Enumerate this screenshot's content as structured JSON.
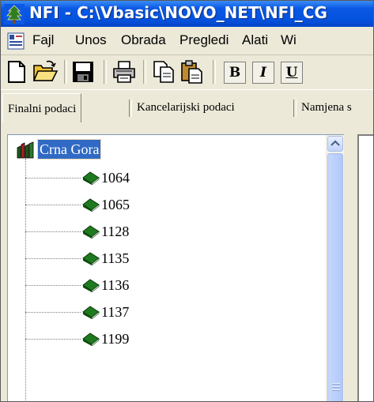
{
  "window": {
    "title": "NFI - C:\\Vbasic\\NOVO_NET\\NFI_CG"
  },
  "menu": {
    "items": [
      "Fajl",
      "Unos",
      "Obrada",
      "Pregledi",
      "Alati",
      "Wi"
    ]
  },
  "toolbar": {
    "buttons": [
      "new-document-icon",
      "open-folder-icon",
      "save-icon",
      "print-icon",
      "copy-icon",
      "paste-icon"
    ],
    "format": {
      "bold": "B",
      "italic": "I",
      "underline": "U"
    }
  },
  "tabs": [
    {
      "label": "Finalni podaci",
      "active": true
    },
    {
      "label": "Kancelarijski podaci",
      "active": false
    },
    {
      "label": "Namjena s",
      "active": false
    }
  ],
  "tree": {
    "root": {
      "label": "Crna Gora",
      "selected": true
    },
    "items": [
      "1064",
      "1065",
      "1128",
      "1135",
      "1136",
      "1137",
      "1199"
    ]
  },
  "colors": {
    "titlebar": "#0553df",
    "selection": "#316ac5",
    "book_icon": "#1f7a1f",
    "window_bg": "#ece9d8"
  }
}
